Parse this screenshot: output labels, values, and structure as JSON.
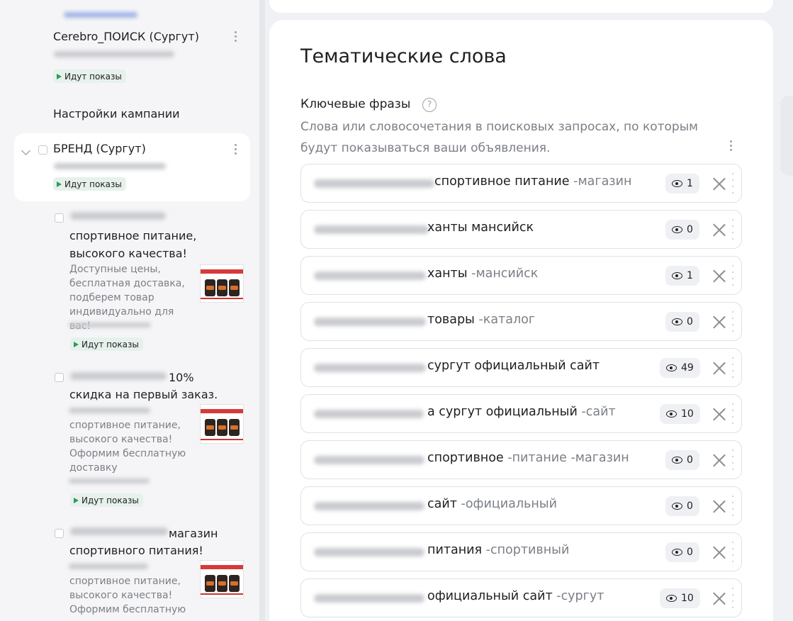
{
  "sidebar": {
    "campaign_search": {
      "title": "Cerebro_ПОИСК (Сургут)",
      "status": "Идут показы"
    },
    "settings_link": "Настройки кампании",
    "campaign_brand": {
      "title": "БРЕНД (Сургут)",
      "status": "Идут показы"
    },
    "ads": [
      {
        "title": "спортивное питание, высокого качества!",
        "text": "Доступные цены, бесплатная доставка, подберем товар индивидуально для вас!",
        "status": "Идут показы"
      },
      {
        "title_suffix": "10%",
        "title": "скидка на первый заказ.",
        "text": "спортивное питание, высокого качества! Оформим бесплатную доставку",
        "status": "Идут показы"
      },
      {
        "title_suffix": "магазин",
        "title": "спортивного питания!",
        "text": "спортивное питание, высокого качества! Оформим бесплатную"
      }
    ]
  },
  "main": {
    "heading": "Тематические слова",
    "keywords_label": "Ключевые фразы",
    "help_glyph": "?",
    "description": "Слова или словосочетания в поисковых запросах, по которым будут показываться ваши объявления.",
    "keywords": [
      {
        "text": "спортивное питание",
        "minus": "-магазин",
        "shows": "1"
      },
      {
        "text": "ханты мансийск",
        "minus": "",
        "shows": "0"
      },
      {
        "text": "ханты",
        "minus": "-мансийск",
        "shows": "1"
      },
      {
        "text": "товары",
        "minus": "-каталог",
        "shows": "0"
      },
      {
        "text": "сургут официальный сайт",
        "minus": "",
        "shows": "49"
      },
      {
        "text": "а сургут официальный",
        "minus": "-сайт",
        "shows": "10"
      },
      {
        "text": "спортивное",
        "minus": "-питание -магазин",
        "shows": "0"
      },
      {
        "text": "сайт",
        "minus": "-официальный",
        "shows": "0"
      },
      {
        "text": "питания",
        "minus": "-спортивный",
        "shows": "0"
      },
      {
        "text": "официальный сайт",
        "minus": "-сургут",
        "shows": "10"
      }
    ]
  },
  "colors": {
    "status_green": "#2e9a5c",
    "text_primary": "#1f1f1f",
    "text_secondary": "#7b7f86",
    "page_bg": "#f0f1f4"
  }
}
